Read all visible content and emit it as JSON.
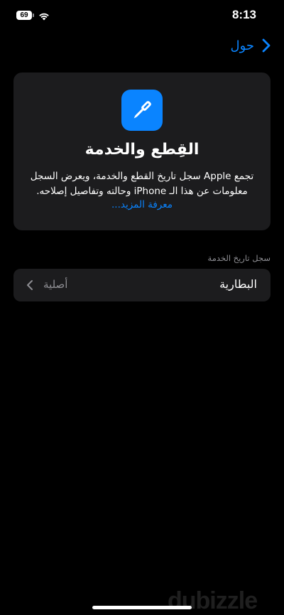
{
  "status_bar": {
    "battery_level": "69",
    "time": "8:13"
  },
  "nav": {
    "back_label": "حول"
  },
  "info_card": {
    "icon": "screwdriver-icon",
    "title": "القِطع والخدمة",
    "description": "تجمع Apple سجل تاريخ القطع والخدمة، ويعرض السجل معلومات عن هذا الـ iPhone وحالته وتفاصيل إصلاحه.",
    "learn_more": "معرفة المزيد..."
  },
  "service_history": {
    "header": "سجل تاريخ الخدمة",
    "rows": [
      {
        "label": "البطارية",
        "value": "أصلية"
      }
    ]
  },
  "watermark": "dubizzle",
  "colors": {
    "accent": "#0a84ff",
    "card_bg": "#1c1c1e",
    "secondary_text": "#8e8e93"
  }
}
